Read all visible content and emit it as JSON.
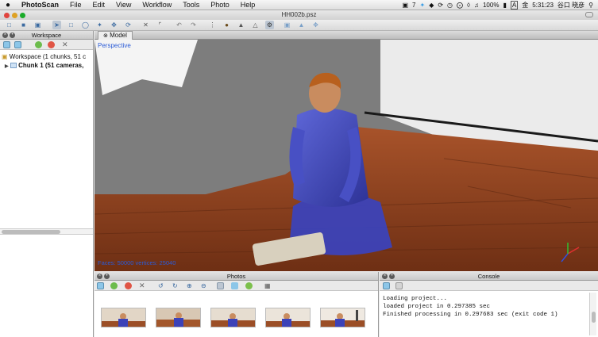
{
  "menubar": {
    "app": "PhotoScan",
    "items": [
      "File",
      "Edit",
      "View",
      "Workflow",
      "Tools",
      "Photo",
      "Help"
    ],
    "status_num": "7",
    "battery": "100%",
    "day": "金",
    "clock": "5:31:23",
    "user": "谷口 晓彦"
  },
  "window": {
    "title": "HH002b.psz"
  },
  "workspace": {
    "title": "Workspace",
    "root_label": "Workspace (1 chunks, 51 c",
    "chunk_label": "Chunk 1 (51 cameras,"
  },
  "model": {
    "tab_label": "Model",
    "view_label": "Perspective",
    "stats": "Faces: 50000 vertices: 25040"
  },
  "photos": {
    "title": "Photos",
    "thumb_count": 5
  },
  "console": {
    "title": "Console",
    "lines": [
      "Loading project...",
      "loaded project in 0.297385 sec",
      "Finished processing in 0.297683 sec (exit code 1)"
    ]
  },
  "colors": {
    "accent": "#3b6aa0",
    "view_label": "#2a5bd7",
    "shirt": "#3c42b8"
  }
}
